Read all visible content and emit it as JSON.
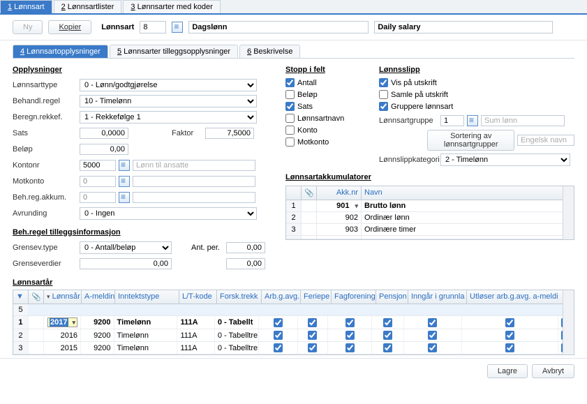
{
  "topTabs": [
    {
      "prefix": "1",
      "label": "Lønnsart",
      "active": true
    },
    {
      "prefix": "2",
      "label": "Lønnsartlister",
      "active": false
    },
    {
      "prefix": "3",
      "label": "Lønnsarter med koder",
      "active": false
    }
  ],
  "toolbar": {
    "ny": "Ny",
    "kopier": "Kopier",
    "label": "Lønnsart",
    "code": "8",
    "nameNo": "Dagslønn",
    "nameEn": "Daily salary"
  },
  "subTabs": [
    {
      "prefix": "4",
      "label": "Lønnsartopplysninger",
      "active": true
    },
    {
      "prefix": "5",
      "label": "Lønnsarter tilleggsopplysninger",
      "active": false
    },
    {
      "prefix": "6",
      "label": "Beskrivelse",
      "active": false
    }
  ],
  "opplysninger": {
    "title": "Opplysninger",
    "lonnsarttypeLabel": "Lønnsarttype",
    "lonnsarttype": "0 - Lønn/godtgjørelse",
    "behandlregelLabel": "Behandl.regel",
    "behandlregel": "10 - Timelønn",
    "beregnrekkeLabel": "Beregn.rekkef.",
    "beregnrekke": "1 - Rekkefølge 1",
    "satsLabel": "Sats",
    "sats": "0,0000",
    "faktorLabel": "Faktor",
    "faktor": "7,5000",
    "belopLabel": "Beløp",
    "belop": "0,00",
    "kontonrLabel": "Kontonr",
    "kontonr": "5000",
    "kontonrTxt": "Lønn til ansatte",
    "motkontoLabel": "Motkonto",
    "motkonto": "0",
    "behregakkLabel": "Beh.reg.akkum.",
    "behregakk": "0",
    "avrundingLabel": "Avrunding",
    "avrunding": "0 - Ingen"
  },
  "tillegg": {
    "title": "Beh.regel tilleggsinformasjon",
    "grensevtypeLabel": "Grensev.type",
    "grensevtype": "0 - Antall/beløp",
    "antperLabel": "Ant. per.",
    "antper": "0,00",
    "grenseverdierLabel": "Grenseverdier",
    "grenseverdier1": "0,00",
    "grenseverdier2": "0,00"
  },
  "stopp": {
    "title": "Stopp i felt",
    "antall": "Antall",
    "belop": "Beløp",
    "sats": "Sats",
    "lonnsartnavn": "Lønnsartnavn",
    "konto": "Konto",
    "motkonto": "Motkonto"
  },
  "slip": {
    "title": "Lønnsslipp",
    "vis": "Vis på utskrift",
    "samle": "Samle på utskrift",
    "gruppere": "Gruppere lønnsart",
    "gruppeLabel": "Lønnsartgruppe",
    "gruppe": "1",
    "gruppeTxt": "Sum lønn",
    "sortBtn": "Sortering av lønnsartgrupper",
    "engelsk": "Engelsk navn",
    "kategoriLabel": "Lønnslippkategori",
    "kategori": "2 - Timelønn"
  },
  "akk": {
    "title": "Lønnsartakkumulatorer",
    "hdrNr": "Akk.nr",
    "hdrNavn": "Navn",
    "rows": [
      {
        "n": "1",
        "nr": "901",
        "navn": "Brutto lønn",
        "bold": true,
        "drop": true
      },
      {
        "n": "2",
        "nr": "902",
        "navn": "Ordinær lønn"
      },
      {
        "n": "3",
        "nr": "903",
        "navn": "Ordinære timer"
      },
      {
        "n": "",
        "nr": "",
        "navn": ""
      }
    ]
  },
  "year": {
    "title": "Lønnsartår",
    "headers": [
      "",
      "",
      "Lønnsår",
      "A-meldin",
      "Inntektstype",
      "L/T-kode",
      "Forsk.trekk",
      "Arb.g.avg.",
      "Feriepe",
      "Fagforening",
      "Pensjon",
      "Inngår i grunnla",
      "Utløser arb.g.avg. a-meldi"
    ],
    "rows": [
      {
        "n": "5",
        "blank": true
      },
      {
        "n": "1",
        "year": "2017",
        "am": "9200",
        "type": "Timelønn",
        "lt": "111A",
        "ft": "0 - Tabellt",
        "c": [
          true,
          true,
          true,
          true,
          true,
          true,
          true
        ],
        "bold": true,
        "edit": true
      },
      {
        "n": "2",
        "year": "2016",
        "am": "9200",
        "type": "Timelønn",
        "lt": "111A",
        "ft": "0 - Tabelltre",
        "c": [
          true,
          true,
          true,
          true,
          true,
          true,
          true
        ]
      },
      {
        "n": "3",
        "year": "2015",
        "am": "9200",
        "type": "Timelønn",
        "lt": "111A",
        "ft": "0 - Tabelltre",
        "c": [
          true,
          true,
          true,
          true,
          true,
          true,
          true
        ]
      }
    ]
  },
  "footer": {
    "lagre": "Lagre",
    "avbryt": "Avbryt"
  }
}
